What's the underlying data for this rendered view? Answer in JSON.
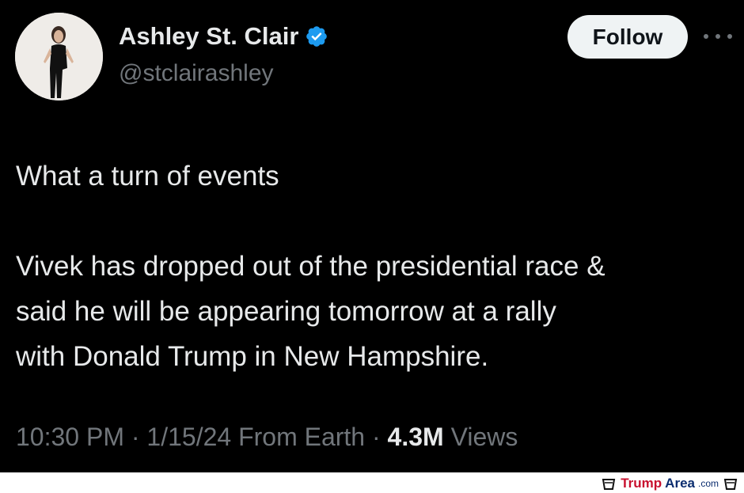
{
  "tweet": {
    "author_name": "Ashley St. Clair",
    "handle": "@stclairashley",
    "follow_label": "Follow",
    "lines": [
      "What a turn of events",
      "Vivek has dropped out of the presidential race &",
      "said he will be appearing tomorrow at a rally",
      "with Donald Trump in New Hampshire."
    ],
    "time": "10:30 PM",
    "date": "1/15/24",
    "source": "From Earth",
    "views_count": "4.3M",
    "views_label": "Views",
    "separator": "·"
  },
  "watermark": {
    "trump": "Trump",
    "area": "Area",
    "com": ".com"
  },
  "colors": {
    "background": "#000000",
    "text_primary": "#e7e9ea",
    "text_secondary": "#71767b",
    "verified_blue": "#1d9bf0",
    "follow_bg": "#eff3f4"
  },
  "icons": {
    "verified": "verified-badge-icon",
    "more": "more-options-icon"
  }
}
